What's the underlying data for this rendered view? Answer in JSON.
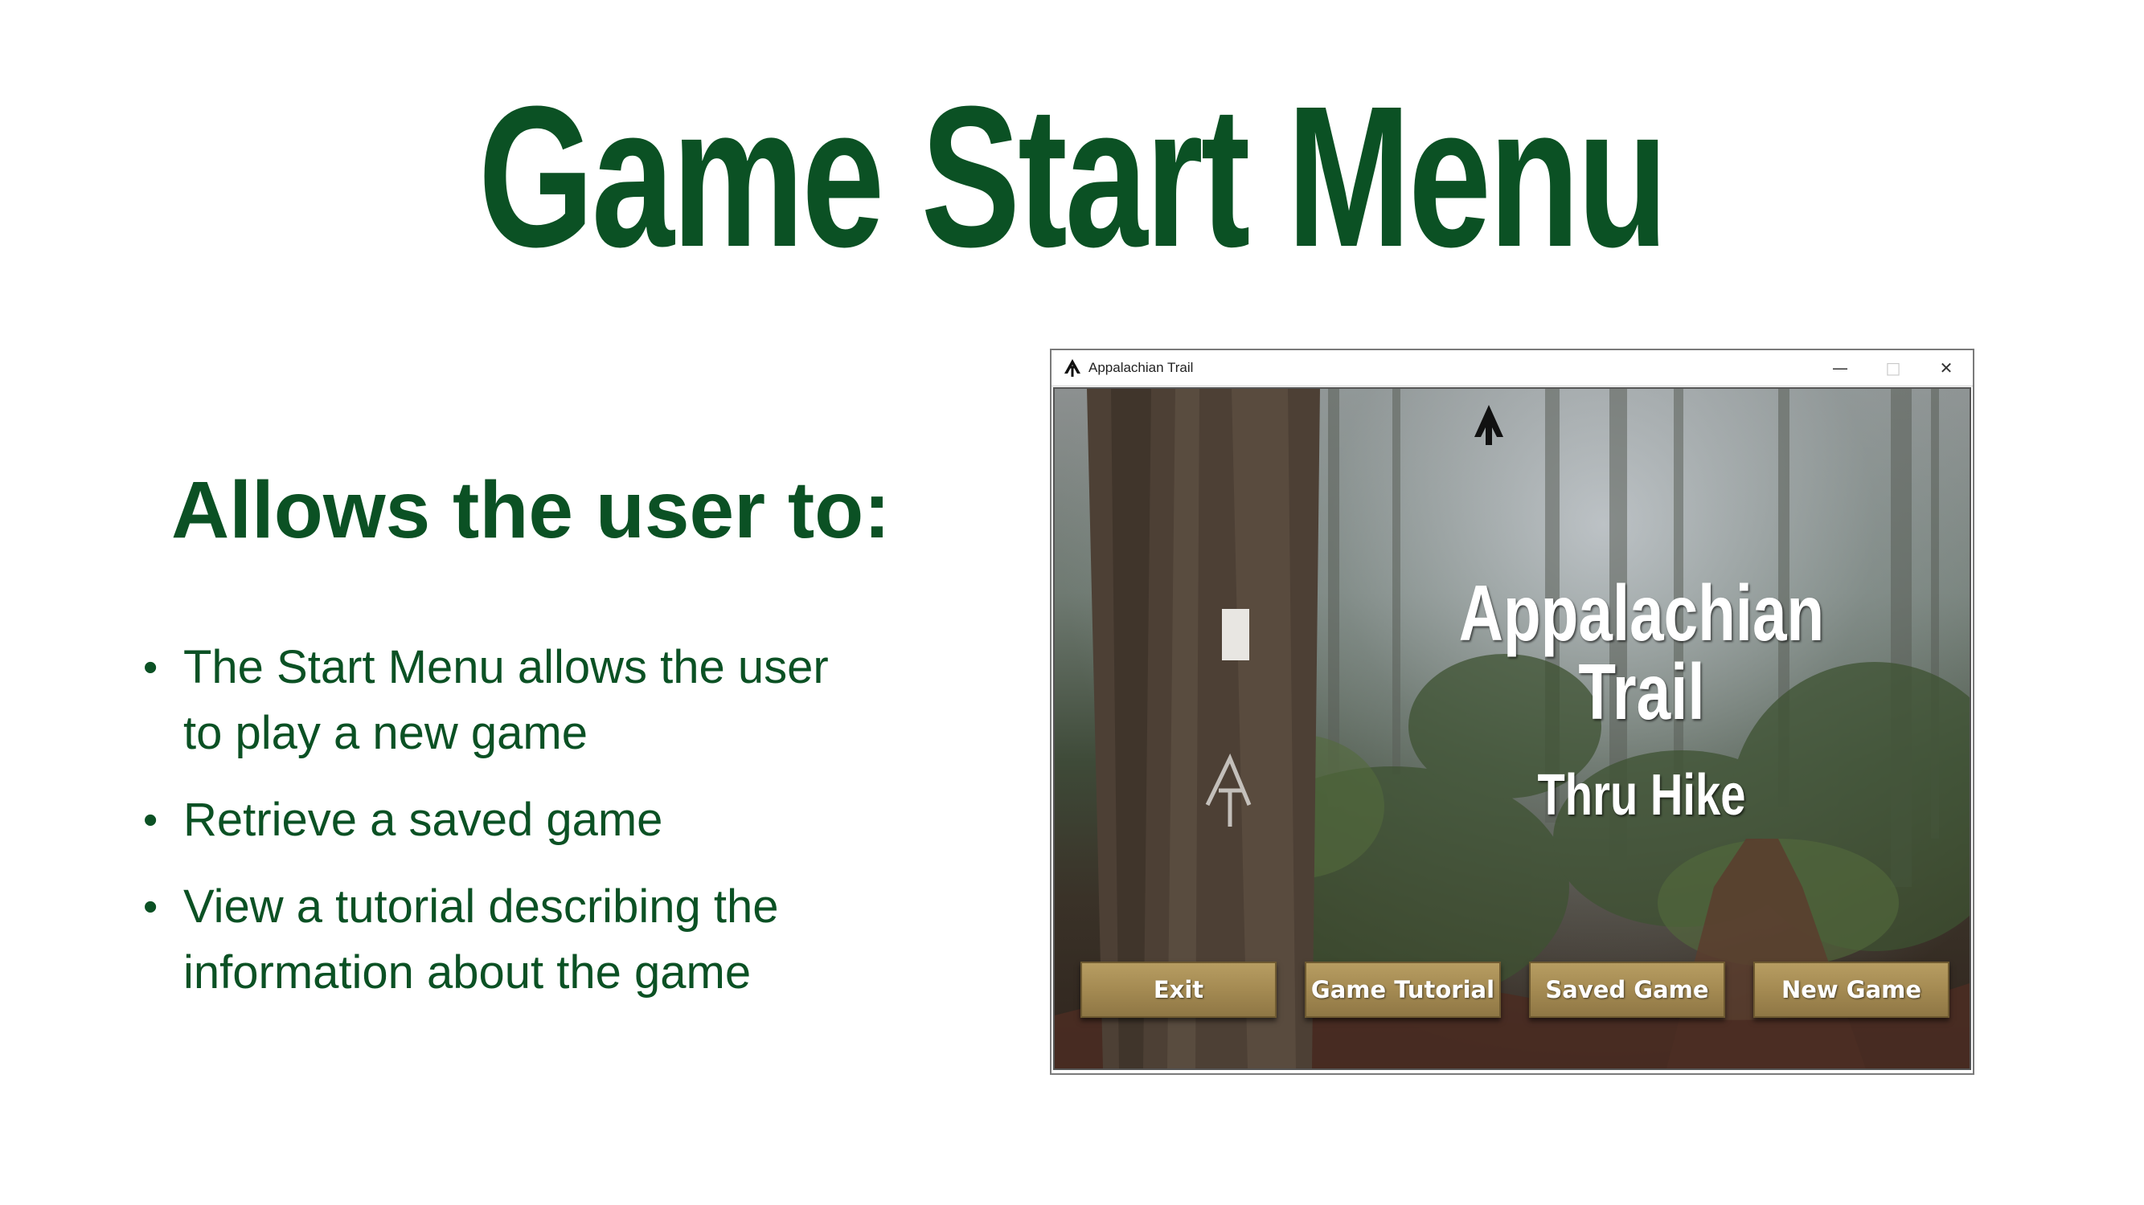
{
  "slide": {
    "title": "Game Start Menu",
    "subheading": "Allows the user to:",
    "bullets": [
      "The Start Menu allows the user to play a new game",
      "Retrieve a saved game",
      "View a tutorial describing the information about the game"
    ]
  },
  "app_window": {
    "title": "Appalachian Trail",
    "icon": "at-trail-logo-icon",
    "controls": [
      "minimize",
      "maximize",
      "close"
    ],
    "game": {
      "title": "Appalachian Trail",
      "subtitle": "Thru Hike",
      "buttons": [
        {
          "label": "Exit"
        },
        {
          "label": "Game Tutorial"
        },
        {
          "label": "Saved Game"
        },
        {
          "label": "New Game"
        }
      ]
    }
  },
  "colors": {
    "heading_green": "#0b5124",
    "button_tan": "#a48a52"
  }
}
